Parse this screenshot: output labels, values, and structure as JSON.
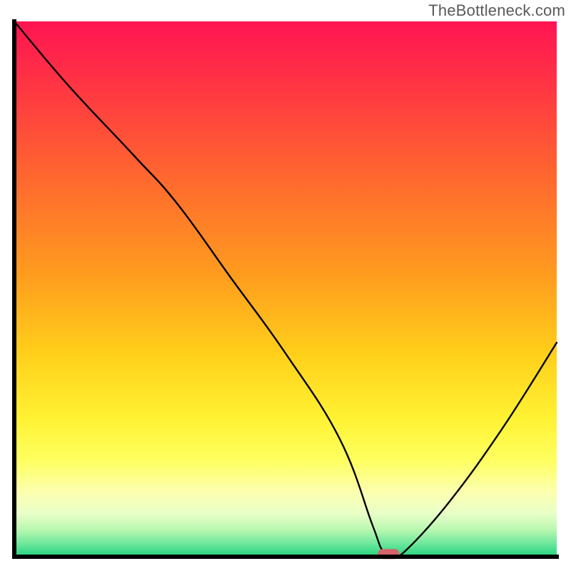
{
  "watermark": "TheBottleneck.com",
  "chart_data": {
    "type": "line",
    "title": "",
    "xlabel": "",
    "ylabel": "",
    "xlim": [
      0,
      100
    ],
    "ylim": [
      0,
      100
    ],
    "grid": false,
    "series": [
      {
        "name": "bottleneck-curve",
        "x": [
          0,
          10,
          22,
          30,
          40,
          50,
          60,
          66,
          68,
          70,
          72,
          80,
          90,
          100
        ],
        "y": [
          100,
          88,
          75,
          66,
          52,
          38,
          22,
          6,
          1,
          0.5,
          1,
          10,
          24,
          40
        ]
      }
    ],
    "marker": {
      "name": "optimal-point",
      "x_range": [
        67,
        71
      ],
      "y": 0.5,
      "color": "#d6636b"
    },
    "gradient_stops": [
      {
        "offset": 0.0,
        "color": "#ff1452"
      },
      {
        "offset": 0.12,
        "color": "#ff3543"
      },
      {
        "offset": 0.3,
        "color": "#ff6a2e"
      },
      {
        "offset": 0.48,
        "color": "#ff9e1e"
      },
      {
        "offset": 0.62,
        "color": "#ffcf1a"
      },
      {
        "offset": 0.74,
        "color": "#fff232"
      },
      {
        "offset": 0.82,
        "color": "#feff60"
      },
      {
        "offset": 0.88,
        "color": "#fcffb0"
      },
      {
        "offset": 0.92,
        "color": "#e8ffc8"
      },
      {
        "offset": 0.95,
        "color": "#b8f7b0"
      },
      {
        "offset": 0.975,
        "color": "#6fe89c"
      },
      {
        "offset": 1.0,
        "color": "#22d17f"
      }
    ]
  }
}
